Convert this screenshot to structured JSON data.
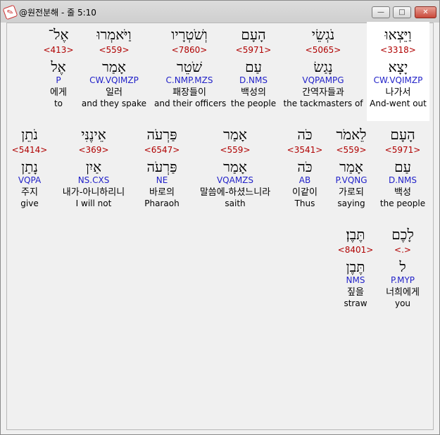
{
  "window": {
    "title": "@원전분해 - 줄 5:10",
    "minimize_symbol": "—",
    "maximize_symbol": "□",
    "close_symbol": "✕",
    "app_icon": "app-logo-icon"
  },
  "rows": [
    [
      {
        "hebrew": "וַיֵּצְאוּ",
        "strong": "<3318>",
        "lemma": "יָצָא",
        "parse": "CW.VQIMZP",
        "korean": "나가서",
        "english": "And-went out"
      },
      {
        "hebrew": "נֹגְשֵׂי",
        "strong": "<5065>",
        "lemma": "נָגַשׂ",
        "parse": "VQPAMPG",
        "korean": "간역자들과",
        "english": "the tackmasters of"
      },
      {
        "hebrew": "הָעָם",
        "strong": "<5971>",
        "lemma": "עַם",
        "parse": "D.NMS",
        "korean": "백성의",
        "english": "the people"
      },
      {
        "hebrew": "וְשֹׁטְרָיו",
        "strong": "<7860>",
        "lemma": "שֹׁטֵר",
        "parse": "C.NMP.MZS",
        "korean": "패장들이",
        "english": "and their officers"
      },
      {
        "hebrew": "וַיֹּאמְרוּ",
        "strong": "<559>",
        "lemma": "אָמַר",
        "parse": "CW.VQIMZP",
        "korean": "일러",
        "english": "and they spake"
      },
      {
        "hebrew": "אֶל־",
        "strong": "<413>",
        "lemma": "אֶל",
        "parse": "P",
        "korean": "에게",
        "english": "to"
      }
    ],
    [
      {
        "hebrew": "הָעָם",
        "strong": "<5971>",
        "lemma": "עַם",
        "parse": "D.NMS",
        "korean": "백성",
        "english": "the people"
      },
      {
        "hebrew": "לֵאמֹר",
        "strong": "<559>",
        "lemma": "אָמַר",
        "parse": "P.VQNG",
        "korean": "가로되",
        "english": "saying"
      },
      {
        "hebrew": "כֹּה",
        "strong": "<3541>",
        "lemma": "כֹּה",
        "parse": "AB",
        "korean": "이같이",
        "english": "Thus"
      },
      {
        "hebrew": "אָמַר",
        "strong": "<559>",
        "lemma": "אָמַר",
        "parse": "VQAMZS",
        "korean": "말씀에-하셨느니라",
        "english": "saith"
      },
      {
        "hebrew": "פַּרְעֹה",
        "strong": "<6547>",
        "lemma": "פַּרְעֹה",
        "parse": "NE",
        "korean": "바로의",
        "english": "Pharaoh"
      },
      {
        "hebrew": "אֵינֶנִּי",
        "strong": "<369>",
        "lemma": "אַיִן",
        "parse": "NS.CXS",
        "korean": "내가-아니하리니",
        "english": "I will not"
      },
      {
        "hebrew": "נֹתֵן",
        "strong": "<5414>",
        "lemma": "נָתַן",
        "parse": "VQPA",
        "korean": "주지",
        "english": "give"
      }
    ],
    [
      {
        "hebrew": "לָכֶם",
        "strong": "<.>",
        "lemma": "ל",
        "parse": "P.MYP",
        "korean": "너희에게",
        "english": "you"
      },
      {
        "hebrew": "תֶּבֶן׃",
        "strong": "<8401>",
        "lemma": "תֶּבֶן",
        "parse": "NMS",
        "korean": "짚을",
        "english": "straw"
      }
    ]
  ]
}
